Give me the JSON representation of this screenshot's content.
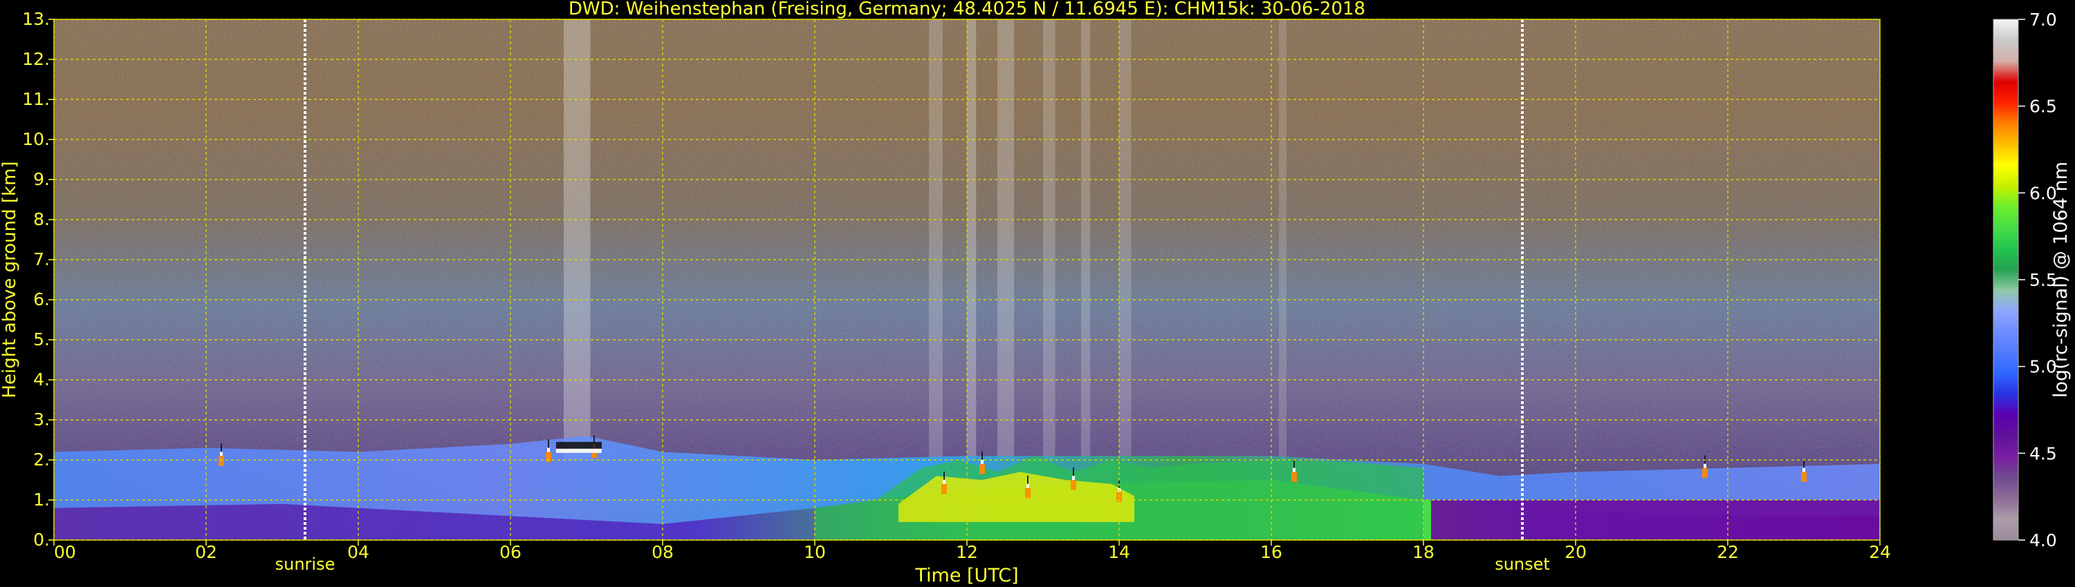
{
  "chart_data": {
    "type": "heatmap",
    "title": "DWD: Weihenstephan (Freising, Germany; 48.4025 N / 11.6945 E):    CHM15k: 30-06-2018",
    "xlabel": "Time [UTC]",
    "ylabel": "Height above ground [km]",
    "colorbar_label": "log(rc-signal) @ 1064 nm",
    "xlim": [
      0,
      24
    ],
    "ylim": [
      0,
      13
    ],
    "x_ticks": [
      0,
      2,
      4,
      6,
      8,
      10,
      12,
      14,
      16,
      18,
      20,
      22,
      24
    ],
    "x_tick_labels": [
      "00",
      "02",
      "04",
      "06",
      "08",
      "10",
      "12",
      "14",
      "16",
      "18",
      "20",
      "22",
      "24"
    ],
    "y_ticks": [
      0,
      1,
      2,
      3,
      4,
      5,
      6,
      7,
      8,
      9,
      10,
      11,
      12,
      13
    ],
    "y_tick_labels": [
      "0.",
      "1.",
      "2.",
      "3.",
      "4.",
      "5.",
      "6.",
      "7.",
      "8.",
      "9.",
      "10.",
      "11.",
      "12.",
      "13."
    ],
    "colorbar_range": [
      4.0,
      7.0
    ],
    "colorbar_ticks": [
      4.0,
      4.5,
      5.0,
      5.5,
      6.0,
      6.5,
      7.0
    ],
    "colorbar_tick_labels": [
      "4.0",
      "4.5",
      "5.0",
      "5.5",
      "6.0",
      "6.5",
      "7.0"
    ],
    "grid": true,
    "markers": [
      {
        "label": "sunrise",
        "x": 3.3
      },
      {
        "label": "sunset",
        "x": 19.3
      }
    ],
    "layers": {
      "boundary_layer_top": [
        [
          0,
          2.2
        ],
        [
          2,
          2.3
        ],
        [
          4,
          2.2
        ],
        [
          6,
          2.4
        ],
        [
          7,
          2.6
        ],
        [
          8,
          2.2
        ],
        [
          10,
          2.0
        ],
        [
          12,
          2.1
        ],
        [
          14,
          2.1
        ],
        [
          16,
          2.1
        ],
        [
          18,
          1.9
        ],
        [
          19,
          1.6
        ],
        [
          20,
          1.7
        ],
        [
          22,
          1.8
        ],
        [
          24,
          1.9
        ]
      ],
      "mixing_layer_top": [
        [
          0,
          0.8
        ],
        [
          3,
          0.9
        ],
        [
          6,
          0.6
        ],
        [
          8,
          0.4
        ],
        [
          10,
          0.8
        ],
        [
          12,
          1.3
        ],
        [
          14,
          1.4
        ],
        [
          16,
          1.5
        ],
        [
          18,
          1.0
        ],
        [
          20,
          0.7
        ],
        [
          22,
          0.6
        ],
        [
          24,
          0.6
        ]
      ],
      "cloud_events": [
        {
          "x": 2.2,
          "height": 2.1
        },
        {
          "x": 6.5,
          "height": 2.2
        },
        {
          "x": 7.1,
          "height": 2.3
        },
        {
          "x": 11.7,
          "height": 1.4
        },
        {
          "x": 12.2,
          "height": 1.9
        },
        {
          "x": 12.8,
          "height": 1.3
        },
        {
          "x": 13.4,
          "height": 1.5
        },
        {
          "x": 14.0,
          "height": 1.2
        },
        {
          "x": 16.3,
          "height": 1.7
        },
        {
          "x": 21.7,
          "height": 1.8
        },
        {
          "x": 23.0,
          "height": 1.7
        }
      ]
    },
    "colors": {
      "background": "#000000",
      "text": "#ffff33",
      "grid": "#d8d800",
      "boundary_layer": "#6f8cff",
      "mixing_layer": "#26b84a",
      "stable_layer": "#6a0a9f",
      "clouds": "#ff8a00"
    },
    "colorbar_colors": [
      "#9d8b99",
      "#ac9caa",
      "#8d6c95",
      "#6f4a8f",
      "#7a1ea2",
      "#5f129a",
      "#5b00b1",
      "#2a33e2",
      "#2f66ff",
      "#507bff",
      "#6e8cff",
      "#8fa6ff",
      "#8fc8a5",
      "#23a24f",
      "#22c54e",
      "#46dd47",
      "#6bef2a",
      "#c8ef00",
      "#ffff00",
      "#ffbf00",
      "#ff7f00",
      "#ff2200",
      "#e00000",
      "#d4b1aa",
      "#c9c9c9",
      "#f6f6f6"
    ]
  }
}
